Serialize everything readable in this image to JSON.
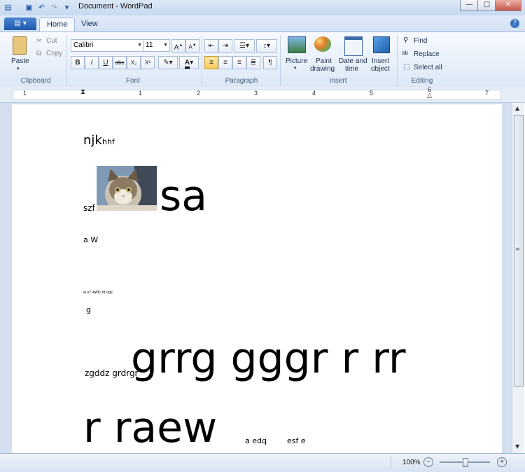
{
  "window": {
    "title": "Document - WordPad"
  },
  "tabs": {
    "home": "Home",
    "view": "View"
  },
  "clipboard": {
    "paste": "Paste",
    "cut": "Cut",
    "copy": "Copy",
    "group": "Clipboard"
  },
  "font": {
    "family": "Calibri",
    "size": "11",
    "group": "Font"
  },
  "paragraph": {
    "group": "Paragraph"
  },
  "insert": {
    "picture": "Picture",
    "paint1": "Paint",
    "paint2": "drawing",
    "date1": "Date and",
    "date2": "time",
    "object1": "Insert",
    "object2": "object",
    "group": "Insert"
  },
  "editing": {
    "find": "Find",
    "replace": "Replace",
    "select_all": "Select all",
    "group": "Editing"
  },
  "ruler": {
    "labels": [
      "1",
      "1",
      "2",
      "3",
      "4",
      "5",
      "6",
      "7"
    ]
  },
  "doc": {
    "line1a": "njk",
    "line1b": "hhf",
    "line2a": "szf",
    "line2b": "sa",
    "line3": "a W",
    "line4": "w e* AWD fd dgs",
    "line5": "g",
    "line6a": "zgddz grdrgr",
    "line6b": "grrg gggr r rr",
    "line7a": "r  raew",
    "line7b": "a edq",
    "line7c": "esf e"
  },
  "status": {
    "zoom": "100%"
  }
}
